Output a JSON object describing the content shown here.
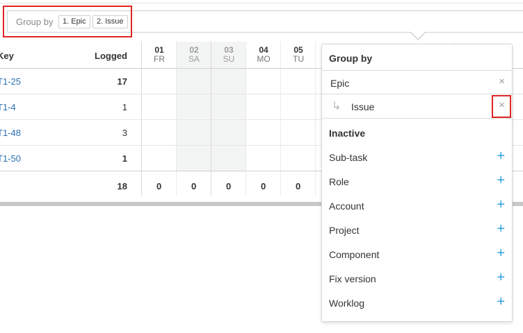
{
  "groupby_bar": {
    "label": "Group by",
    "chips": [
      "1. Epic",
      "2. Issue"
    ]
  },
  "table": {
    "headers": {
      "key": "Key",
      "logged": "Logged"
    },
    "days": [
      {
        "num": "01",
        "dow": "FR",
        "weekend": false
      },
      {
        "num": "02",
        "dow": "SA",
        "weekend": true
      },
      {
        "num": "03",
        "dow": "SU",
        "weekend": true
      },
      {
        "num": "04",
        "dow": "MO",
        "weekend": false
      },
      {
        "num": "05",
        "dow": "TU",
        "weekend": false
      }
    ],
    "rows": [
      {
        "key": "T1-25",
        "logged": "17"
      },
      {
        "key": "T1-4",
        "logged": "1"
      },
      {
        "key": "T1-48",
        "logged": "3"
      },
      {
        "key": "T1-50",
        "logged": "1"
      }
    ],
    "totals": {
      "logged": "18",
      "days": [
        "0",
        "0",
        "0",
        "0",
        "0"
      ]
    }
  },
  "popover": {
    "title": "Group by",
    "active": [
      "Epic",
      "Issue"
    ],
    "inactive_title": "Inactive",
    "inactive": [
      "Sub-task",
      "Role",
      "Account",
      "Project",
      "Component",
      "Fix version",
      "Worklog"
    ],
    "remove_glyph": "×",
    "add_glyph": "+",
    "sub_glyph": "↳"
  },
  "colors": {
    "link": "#2a6fb1",
    "accent": "#2d9fe0",
    "highlight": "#e02424",
    "weekend_bg": "#f3f4f4"
  }
}
